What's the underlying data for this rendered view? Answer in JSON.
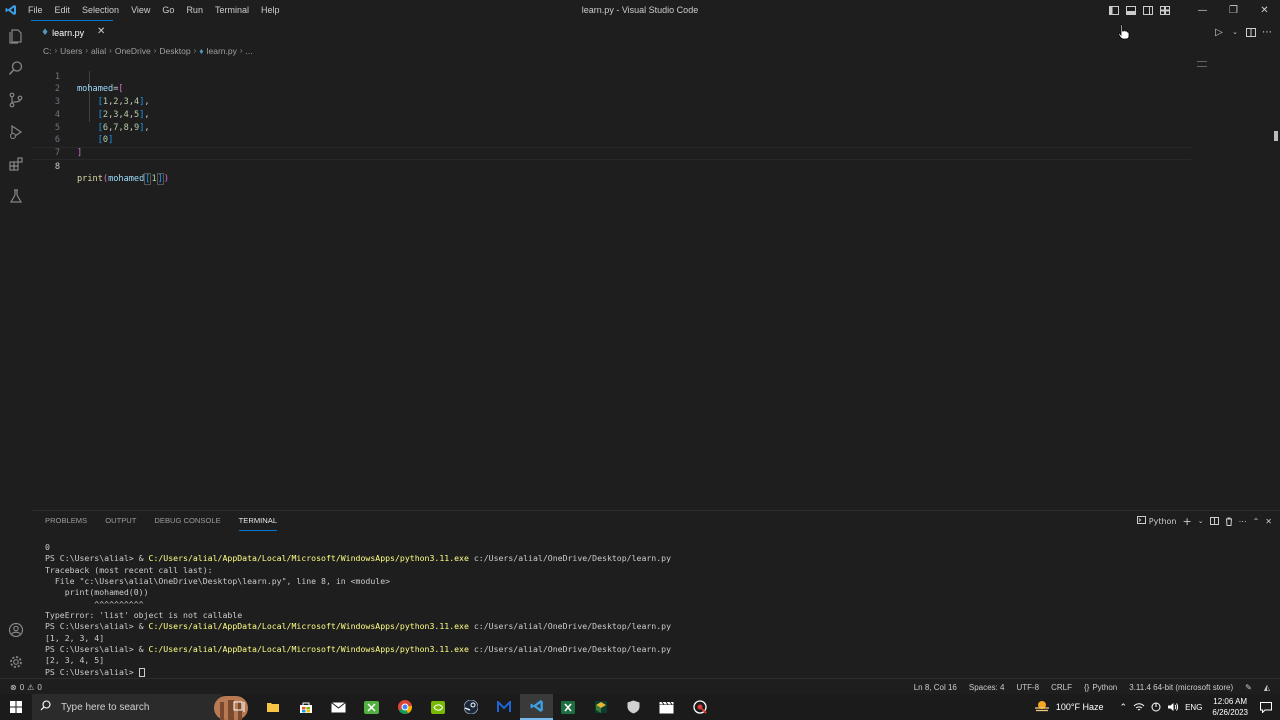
{
  "titlebar": {
    "menu": [
      "File",
      "Edit",
      "Selection",
      "View",
      "Go",
      "Run",
      "Terminal",
      "Help"
    ],
    "title": "learn.py - Visual Studio Code"
  },
  "tab": {
    "label": "learn.py"
  },
  "breadcrumb": [
    "C:",
    "Users",
    "alial",
    "OneDrive",
    "Desktop",
    "learn.py",
    "..."
  ],
  "editor": {
    "line_numbers": [
      "1",
      "2",
      "3",
      "4",
      "5",
      "6",
      "7",
      "8"
    ],
    "current_line": 8
  },
  "panel": {
    "tabs": [
      "PROBLEMS",
      "OUTPUT",
      "DEBUG CONSOLE",
      "TERMINAL"
    ],
    "active_tab": "TERMINAL",
    "shell_label": "Python",
    "terminal": [
      {
        "text": "0"
      },
      {
        "prompt": "PS C:\\Users\\alial> & ",
        "exe": "C:/Users/alial/AppData/Local/Microsoft/WindowsApps/python3.11.exe",
        "arg": " c:/Users/alial/OneDrive/Desktop/learn.py"
      },
      {
        "text": "Traceback (most recent call last):"
      },
      {
        "text": "  File \"c:\\Users\\alial\\OneDrive\\Desktop\\learn.py\", line 8, in <module>"
      },
      {
        "text": "    print(mohamed(0))"
      },
      {
        "text": "          ^^^^^^^^^^"
      },
      {
        "text": "TypeError: 'list' object is not callable"
      },
      {
        "prompt": "PS C:\\Users\\alial> & ",
        "exe": "C:/Users/alial/AppData/Local/Microsoft/WindowsApps/python3.11.exe",
        "arg": " c:/Users/alial/OneDrive/Desktop/learn.py"
      },
      {
        "text": "[1, 2, 3, 4]"
      },
      {
        "prompt": "PS C:\\Users\\alial> & ",
        "exe": "C:/Users/alial/AppData/Local/Microsoft/WindowsApps/python3.11.exe",
        "arg": " c:/Users/alial/OneDrive/Desktop/learn.py"
      },
      {
        "text": "[2, 3, 4, 5]"
      },
      {
        "text": "PS C:\\Users\\alial> ",
        "cursor": true
      }
    ]
  },
  "statusbar": {
    "problems": "0",
    "warnings": "0",
    "position": "Ln 8, Col 16",
    "spaces": "Spaces: 4",
    "encoding": "UTF-8",
    "eol": "CRLF",
    "language": "Python",
    "interpreter": "3.11.4 64-bit (microsoft store)"
  },
  "taskbar": {
    "search_placeholder": "Type here to search",
    "weather": "100°F Haze",
    "lang": "ENG",
    "time": "12:06 AM",
    "date": "6/26/2023"
  },
  "colors": {
    "accent": "#0078d4",
    "background": "#1e1e1e",
    "terminal_command": "#ffff85"
  }
}
